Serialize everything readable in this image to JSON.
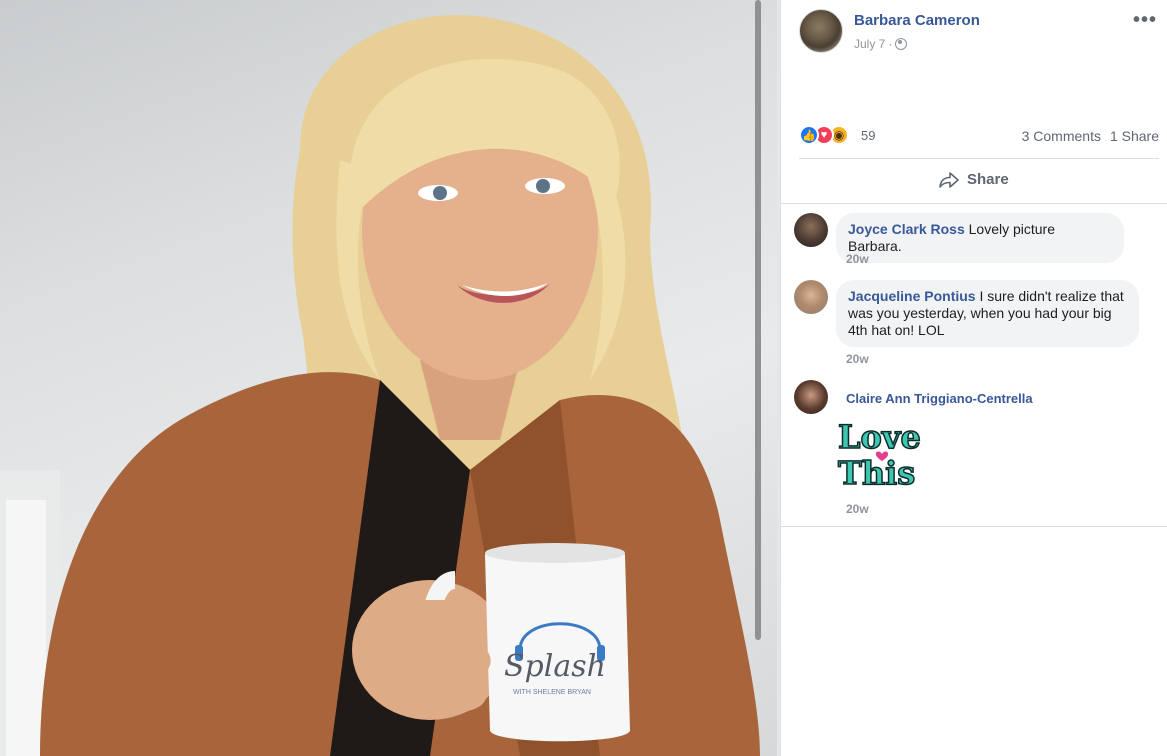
{
  "post": {
    "author": "Barbara Cameron",
    "date": "July 7",
    "privacy_icon": "globe-icon",
    "more_label": "•••"
  },
  "photo": {
    "mug_text_main": "Splash",
    "mug_text_sub": "WITH SHELENE BRYAN"
  },
  "reactions": {
    "types": [
      "like",
      "love",
      "wow"
    ],
    "count": "59",
    "comments": "3 Comments",
    "shares": "1 Share"
  },
  "actions": {
    "share_label": "Share"
  },
  "comments": [
    {
      "author": "Joyce Clark Ross",
      "text": "Lovely picture Barbara.",
      "time": "20w"
    },
    {
      "author": "Jacqueline Pontius",
      "text": "I sure didn't realize that was you yesterday, when you had your big 4th hat on! LOL",
      "time": "20w"
    },
    {
      "author": "Claire Ann Triggiano-Centrella",
      "sticker_line1": "Love",
      "sticker_line2": "This",
      "time": "20w"
    }
  ],
  "colors": {
    "link": "#385898",
    "like": "#1877f2",
    "love": "#f33e58",
    "wow": "#f7b125",
    "sticker": "#3ec7b0"
  }
}
